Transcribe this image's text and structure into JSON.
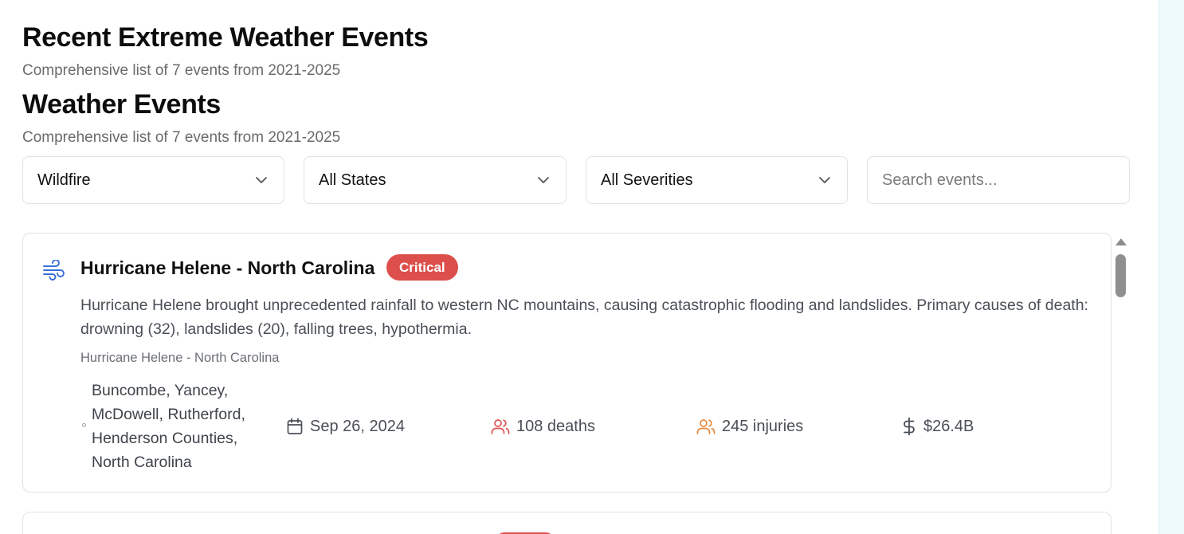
{
  "header": {
    "title": "Recent Extreme Weather Events",
    "subtitle": "Comprehensive list of 7 events from 2021-2025"
  },
  "section": {
    "title": "Weather Events",
    "subtitle": "Comprehensive list of 7 events from 2021-2025"
  },
  "filters": {
    "type_value": "Wildfire",
    "state_value": "All States",
    "severity_value": "All Severities",
    "search_placeholder": "Search events..."
  },
  "events": [
    {
      "icon": "wind-icon",
      "title": "Hurricane Helene - North Carolina",
      "severity": "Critical",
      "description": "Hurricane Helene brought unprecedented rainfall to western NC mountains, causing catastrophic flooding and landslides. Primary causes of death: drowning (32), landslides (20), falling trees, hypothermia.",
      "event_name": "Hurricane Helene - North Carolina",
      "location": "Buncombe, Yancey, McDowell, Rutherford, Henderson Counties, North Carolina",
      "date": "Sep 26, 2024",
      "deaths": "108 deaths",
      "injuries": "245 injuries",
      "damage": "$26.4B"
    }
  ],
  "colors": {
    "critical": "#dc4f4b",
    "deaths_icon": "#e05252",
    "injuries_icon": "#e8883a",
    "wind_icon": "#3b6fd8"
  }
}
